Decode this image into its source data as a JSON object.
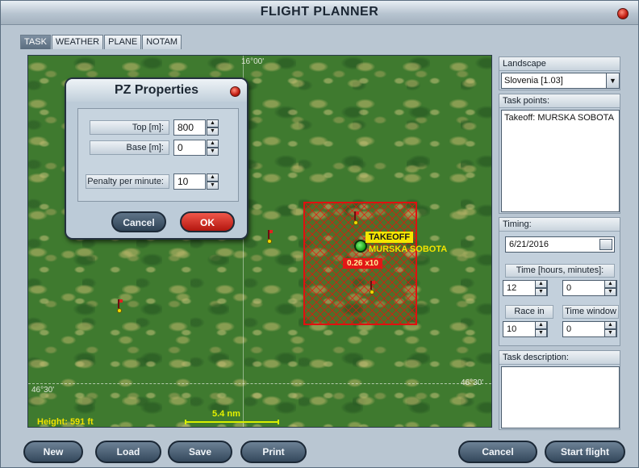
{
  "window": {
    "title": "FLIGHT PLANNER"
  },
  "tabs": [
    {
      "label": "TASK",
      "active": true
    },
    {
      "label": "WEATHER",
      "active": false
    },
    {
      "label": "PLANE",
      "active": false
    },
    {
      "label": "NOTAM",
      "active": false
    }
  ],
  "map": {
    "longitude_label": "16°00'",
    "latitude_label_left": "46°30'",
    "latitude_label_right": "46°30'",
    "takeoff_label": "TAKEOFF",
    "airport_name": "MURSKA SOBOTA",
    "pz_tag": "0.26 x10",
    "height_label": "Height: 591 ft",
    "scale_label": "5.4 nm"
  },
  "pz_dialog": {
    "title": "PZ Properties",
    "top_label": "Top [m]:",
    "top_value": "800",
    "base_label": "Base [m]:",
    "base_value": "0",
    "penalty_label": "Penalty per minute:",
    "penalty_value": "10",
    "cancel_label": "Cancel",
    "ok_label": "OK"
  },
  "landscape": {
    "header": "Landscape",
    "value": "Slovenia [1.03]"
  },
  "task_points": {
    "header": "Task points:",
    "items": [
      "Takeoff: MURSKA SOBOTA"
    ]
  },
  "timing": {
    "header": "Timing:",
    "date": "6/21/2016",
    "time_header": "Time [hours, minutes]:",
    "hours": "12",
    "minutes": "0",
    "race_in_header": "Race in",
    "race_in_value": "10",
    "time_window_header": "Time window",
    "time_window_value": "0"
  },
  "task_description": {
    "header": "Task description:"
  },
  "bottom": {
    "new_label": "New",
    "load_label": "Load",
    "save_label": "Save",
    "print_label": "Print",
    "cancel_label": "Cancel",
    "start_label": "Start flight"
  },
  "colors": {
    "window_bg": "#b9c6d2",
    "close_button": "#c01b10",
    "pz_area": "#e01010",
    "takeoff_marker": "#16a316",
    "label_yellow": "#f6e600"
  }
}
